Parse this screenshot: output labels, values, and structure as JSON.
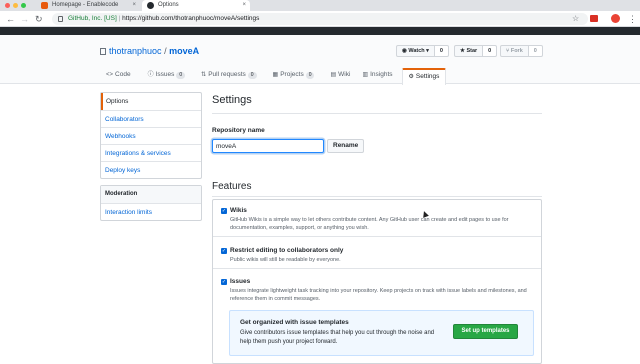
{
  "browser": {
    "tabs": [
      {
        "title": "Homepage - Enablecode"
      },
      {
        "title": "Options"
      }
    ],
    "address": {
      "site_label": "GitHub, Inc. [US]",
      "url": "https://github.com/thotranphuoc/moveA/settings"
    }
  },
  "repo": {
    "owner": "thotranphuoc",
    "separator": "/",
    "name": "moveA",
    "actions": {
      "watch_label": "Watch ▾",
      "watch_count": "0",
      "star_label": "Star",
      "star_count": "0",
      "fork_label": "Fork",
      "fork_count": "0"
    },
    "nav": [
      {
        "label": "Code",
        "icon": "<>"
      },
      {
        "label": "Issues",
        "count": "0",
        "icon": "ⓘ"
      },
      {
        "label": "Pull requests",
        "count": "0",
        "icon": "⇅"
      },
      {
        "label": "Projects",
        "count": "0",
        "icon": "▦"
      },
      {
        "label": "Wiki",
        "icon": "▤"
      },
      {
        "label": "Insights",
        "icon": "▥"
      },
      {
        "label": "Settings",
        "icon": "⚙"
      }
    ]
  },
  "sidebar": {
    "items": [
      "Options",
      "Collaborators",
      "Webhooks",
      "Integrations & services",
      "Deploy keys"
    ],
    "moderation_heading": "Moderation",
    "moderation_items": [
      "Interaction limits"
    ]
  },
  "main": {
    "title": "Settings",
    "repo_name_label": "Repository name",
    "repo_name_value": "moveA",
    "rename_label": "Rename",
    "features_title": "Features",
    "features": [
      {
        "title": "Wikis",
        "desc": "GitHub Wikis is a simple way to let others contribute content. Any GitHub user can create and edit pages to use for documentation, examples, support, or anything you wish."
      },
      {
        "title": "Restrict editing to collaborators only",
        "desc": "Public wikis will still be readable by everyone."
      },
      {
        "title": "Issues",
        "desc": "Issues integrate lightweight task tracking into your repository. Keep projects on track with issue labels and milestones, and reference them in commit messages."
      }
    ],
    "promo": {
      "title": "Get organized with issue templates",
      "desc": "Give contributors issue templates that help you cut through the noise and help them push your project forward.",
      "button": "Set up templates"
    }
  },
  "colors": {
    "link": "#0366d6",
    "accent_tab": "#e36209",
    "primary_button": "#28a745"
  }
}
